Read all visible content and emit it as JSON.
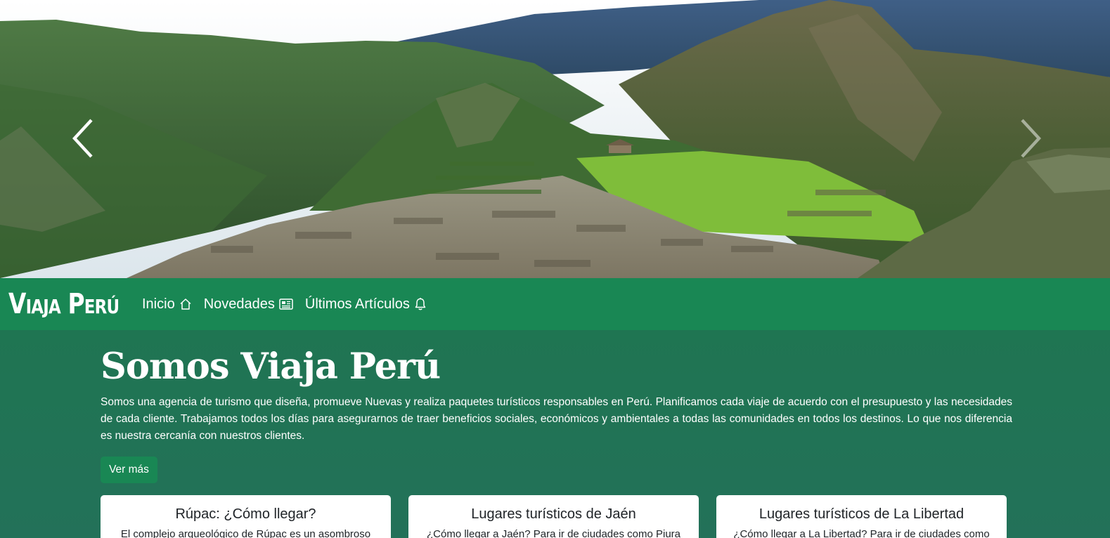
{
  "hero": {
    "prev_icon": "chevron-left-icon",
    "next_icon": "chevron-right-icon"
  },
  "navbar": {
    "brand": "Viaja Perú",
    "items": [
      {
        "label": "Inicio",
        "icon": "house-icon"
      },
      {
        "label": "Novedades",
        "icon": "newspaper-icon"
      },
      {
        "label": "Últimos Artículos",
        "icon": "bell-icon"
      }
    ]
  },
  "main": {
    "title": "Somos Viaja Perú",
    "intro": "Somos una agencia de turismo que diseña, promueve Nuevas y realiza paquetes turísticos responsables en Perú. Planificamos cada viaje de acuerdo con el presupuesto y las necesidades de cada cliente. Trabajamos todos los días para asegurarnos de traer beneficios sociales, económicos y ambientales a todas las comunidades en todos los destinos. Lo que nos diferencia es nuestra cercanía con nuestros clientes.",
    "more_button": "Ver más",
    "cards": [
      {
        "title": "Rúpac: ¿Cómo llegar?",
        "text": "El complejo arqueológico de Rúpac es un asombroso"
      },
      {
        "title": "Lugares turísticos de Jaén",
        "text": "¿Cómo llegar a Jaén? Para ir de ciudades como Piura"
      },
      {
        "title": "Lugares turísticos de La Libertad",
        "text": "¿Cómo llegar a La Libertad? Para ir de ciudades como"
      }
    ]
  },
  "colors": {
    "navbar": "#198754",
    "main_bg": "#1f7552",
    "button": "#198754"
  }
}
